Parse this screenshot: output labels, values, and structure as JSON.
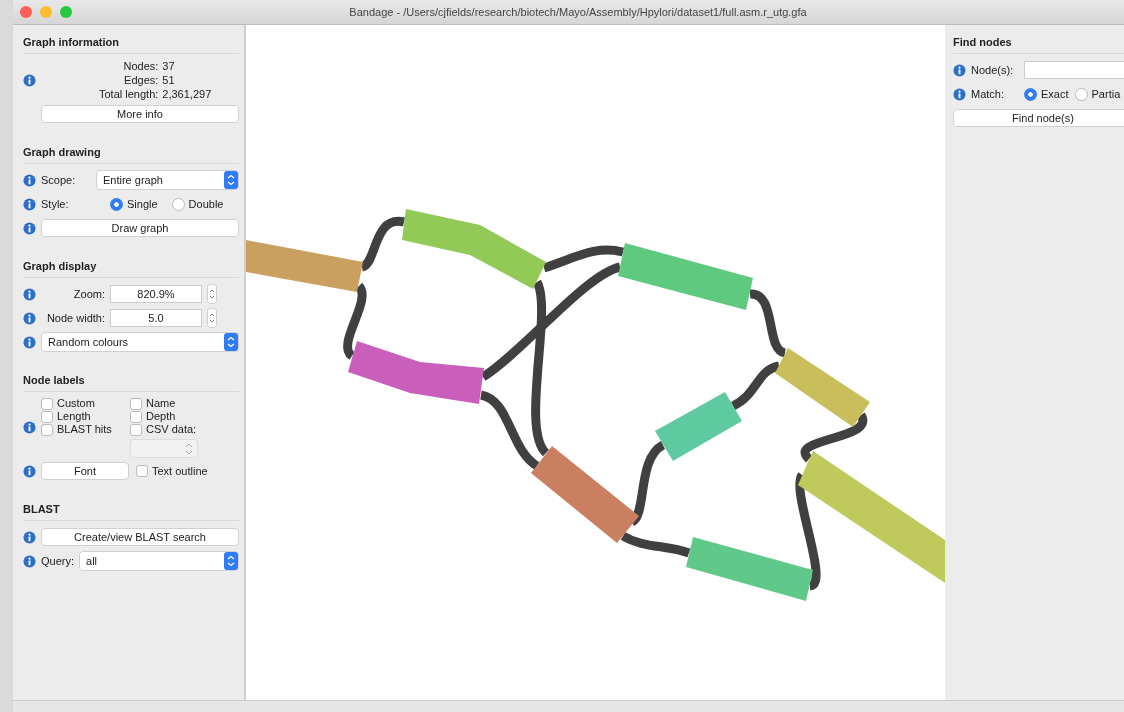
{
  "window": {
    "title": "Bandage - /Users/cjfields/research/biotech/Mayo/Assembly/Hpylori/dataset1/full.asm.r_utg.gfa"
  },
  "graph_information": {
    "title": "Graph information",
    "stats": [
      {
        "label": "Nodes:",
        "value": "37"
      },
      {
        "label": "Edges:",
        "value": "51"
      },
      {
        "label": "Total length:",
        "value": "2,361,297"
      }
    ],
    "more_info_button": "More info"
  },
  "graph_drawing": {
    "title": "Graph drawing",
    "scope": {
      "label": "Scope:",
      "value": "Entire graph"
    },
    "style": {
      "label": "Style:",
      "options": [
        {
          "label": "Single",
          "selected": true
        },
        {
          "label": "Double",
          "selected": false
        }
      ]
    },
    "draw_button": "Draw graph"
  },
  "graph_display": {
    "title": "Graph display",
    "zoom": {
      "label": "Zoom:",
      "value": "820.9%"
    },
    "node_width": {
      "label": "Node width:",
      "value": "5.0"
    },
    "colour_scheme": "Random colours"
  },
  "node_labels": {
    "title": "Node labels",
    "options": [
      {
        "label": "Custom",
        "checked": false
      },
      {
        "label": "Name",
        "checked": false
      },
      {
        "label": "Length",
        "checked": false
      },
      {
        "label": "Depth",
        "checked": false
      },
      {
        "label": "BLAST hits",
        "checked": false
      },
      {
        "label": "CSV data:",
        "checked": false
      }
    ],
    "csv_disabled": true,
    "font_button": "Font",
    "text_outline": {
      "label": "Text outline",
      "checked": false
    }
  },
  "blast": {
    "title": "BLAST",
    "search_button": "Create/view BLAST search",
    "query": {
      "label": "Query:",
      "value": "all"
    }
  },
  "find_nodes": {
    "title": "Find nodes",
    "nodes_label": "Node(s):",
    "match_label": "Match:",
    "options": [
      {
        "label": "Exact",
        "selected": true
      },
      {
        "label": "Partia",
        "selected": false
      }
    ],
    "find_button": "Find node(s)"
  }
}
